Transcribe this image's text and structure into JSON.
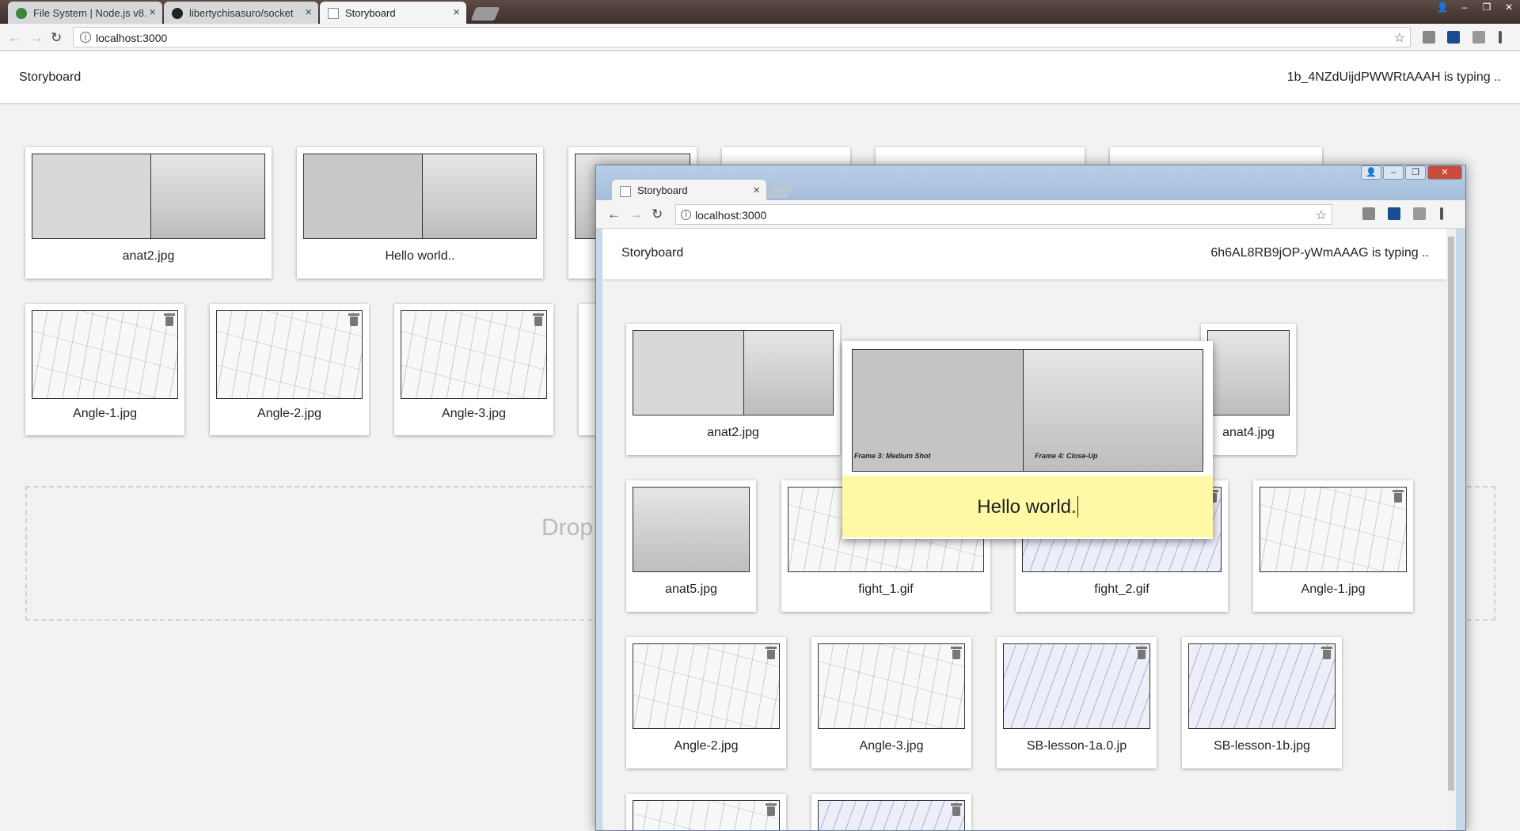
{
  "browser": {
    "tabs": [
      {
        "title": "File System | Node.js v8.",
        "favicon_color": "#3c873a"
      },
      {
        "title": "libertychisasuro/socket",
        "favicon_color": "#222222"
      },
      {
        "title": "Storyboard",
        "favicon_color": "#888888"
      }
    ],
    "url": "localhost:3000"
  },
  "page": {
    "title": "Storyboard",
    "typing_status": "1b_4NZdUijdPWWRtAAAH is typing ..",
    "dropzone_text": "Drop"
  },
  "outer_cards": {
    "row1": [
      {
        "label": "anat2.jpg"
      },
      {
        "label": "Hello world.."
      },
      {
        "label": ""
      },
      {
        "label": ""
      },
      {
        "label": ""
      },
      {
        "label": ""
      }
    ],
    "row2": [
      {
        "label": "Angle-1.jpg"
      },
      {
        "label": "Angle-2.jpg"
      },
      {
        "label": "Angle-3.jpg"
      }
    ]
  },
  "second_window": {
    "tab_title": "Storyboard",
    "url": "localhost:3000",
    "page_title": "Storyboard",
    "typing_status": "6h6AL8RB9jOP-yWmAAAG is typing ..",
    "popup": {
      "caption_left": "Frame 3: Medium Shot",
      "caption_right": "Frame 4: Close-Up",
      "input_value": "Hello world."
    },
    "cards_row1": [
      {
        "label": "anat2.jpg"
      },
      {
        "label": "anat4.jpg"
      }
    ],
    "cards_row2": [
      {
        "label": "anat5.jpg"
      },
      {
        "label": "fight_1.gif"
      },
      {
        "label": "fight_2.gif"
      },
      {
        "label": "Angle-1.jpg"
      }
    ],
    "cards_row3": [
      {
        "label": "Angle-2.jpg"
      },
      {
        "label": "Angle-3.jpg"
      },
      {
        "label": "SB-lesson-1a.0.jp"
      },
      {
        "label": "SB-lesson-1b.jpg"
      }
    ]
  },
  "icons": {
    "back": "back-arrow-icon",
    "forward": "forward-arrow-icon",
    "reload": "reload-icon",
    "star": "bookmark-star-icon",
    "trash": "trash-icon",
    "info": "site-info-icon"
  }
}
